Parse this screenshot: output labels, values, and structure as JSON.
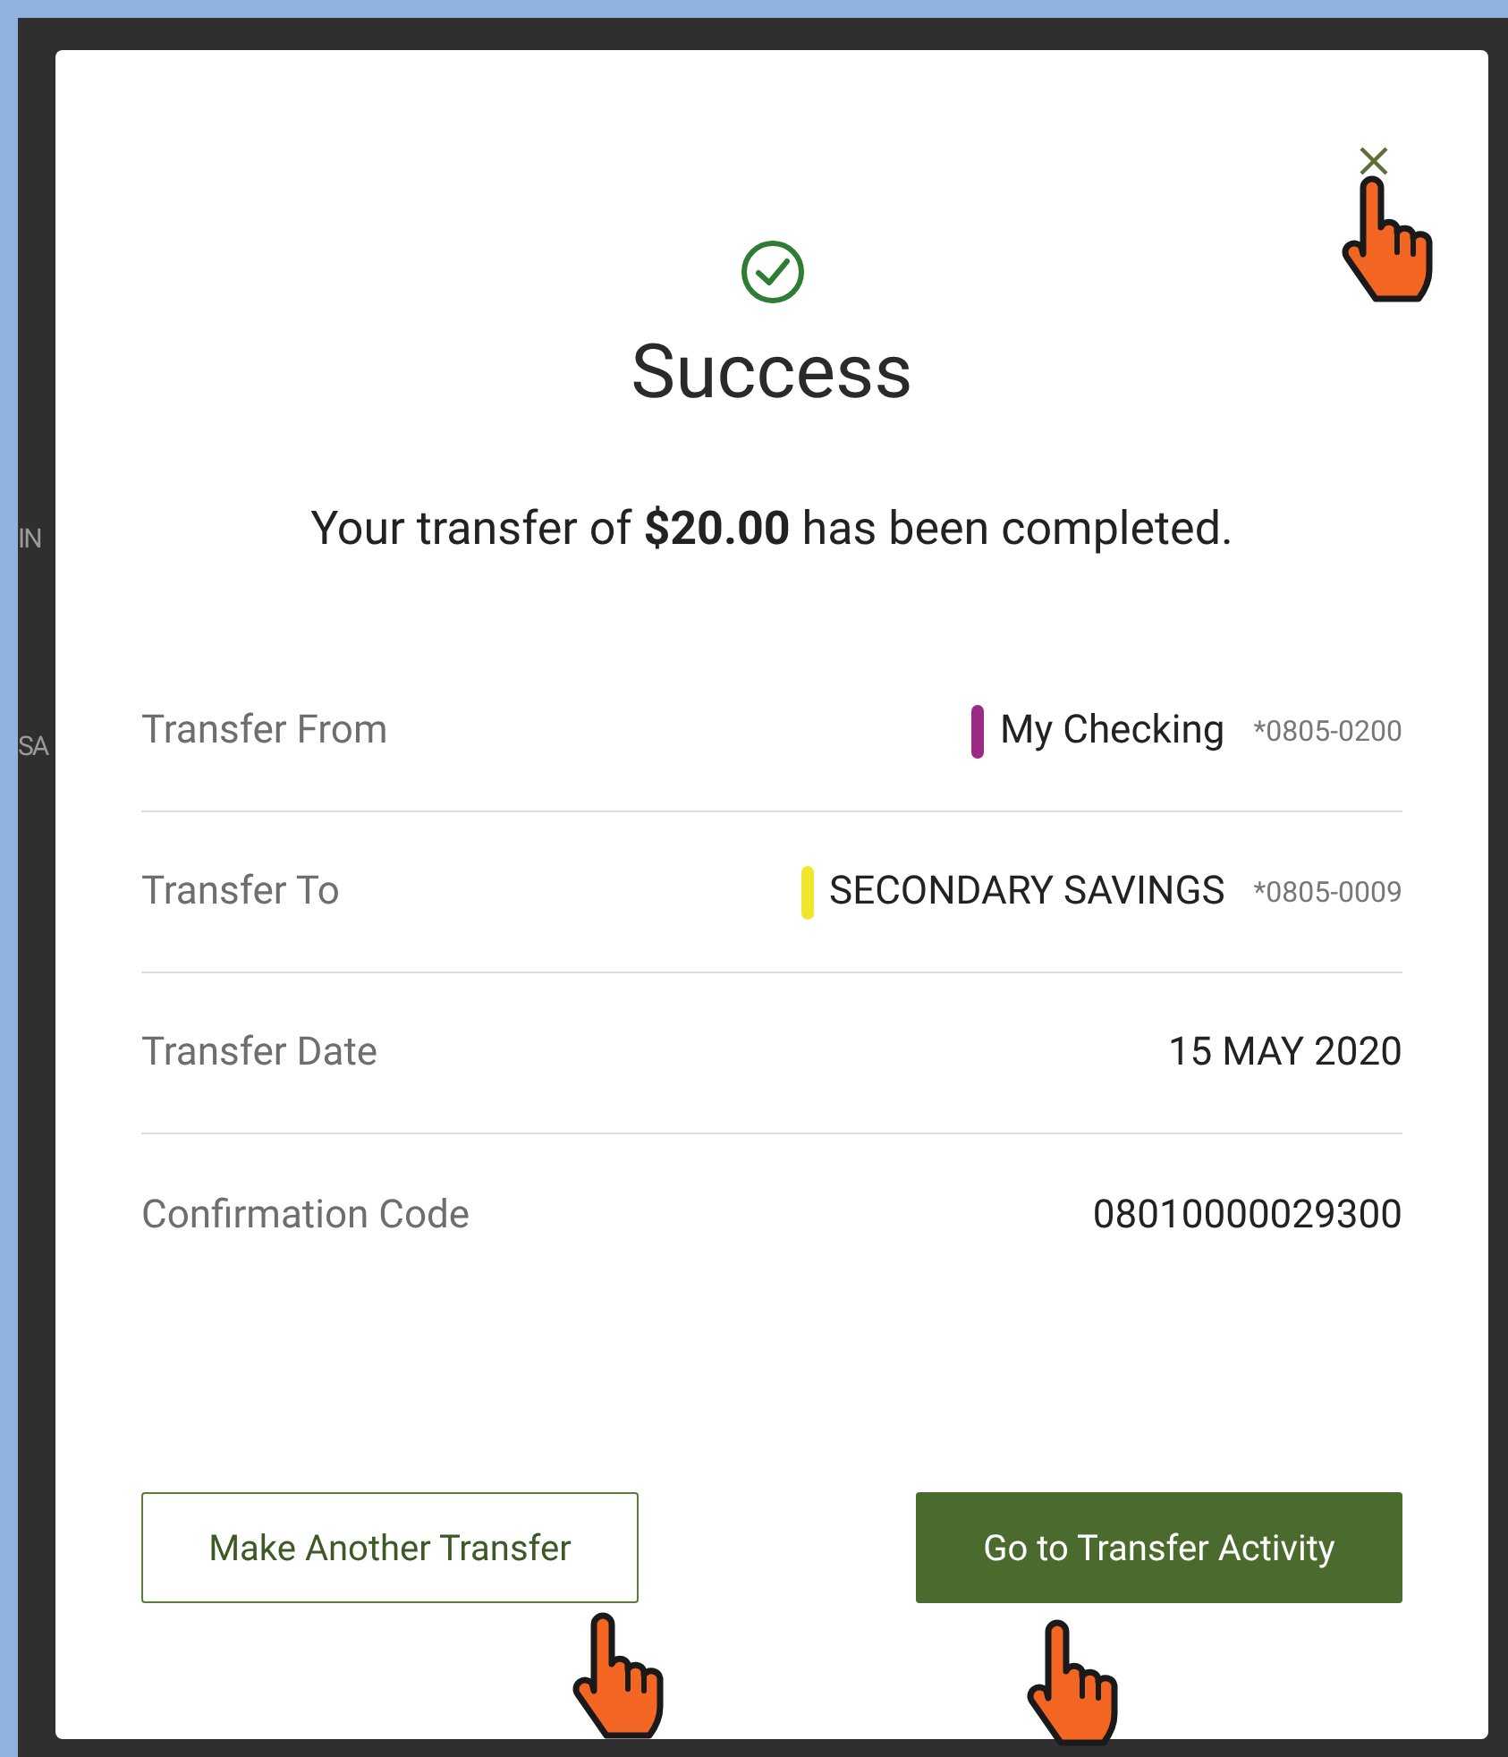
{
  "background": {
    "fragments": [
      "IN",
      "SA"
    ]
  },
  "dialog": {
    "title": "Success",
    "message": "Your transfer of **$20.00** has been completed.",
    "details": [
      {
        "label": "Transfer From",
        "value": "My Checking",
        "account": "*0805-0200",
        "color": "#9c2a83"
      },
      {
        "label": "Transfer To",
        "value": "SECONDARY SAVINGS",
        "account": "*0805-0009",
        "color": "#f0e62c"
      },
      {
        "label": "Transfer Date",
        "value": "15 MAY 2020"
      },
      {
        "label": "Confirmation Code",
        "value": "08010000029300"
      }
    ],
    "buttons": [
      {
        "label": "Make Another Transfer",
        "kind": "secondary"
      },
      {
        "label": "Go to Transfer Activity",
        "kind": "primary"
      }
    ]
  }
}
